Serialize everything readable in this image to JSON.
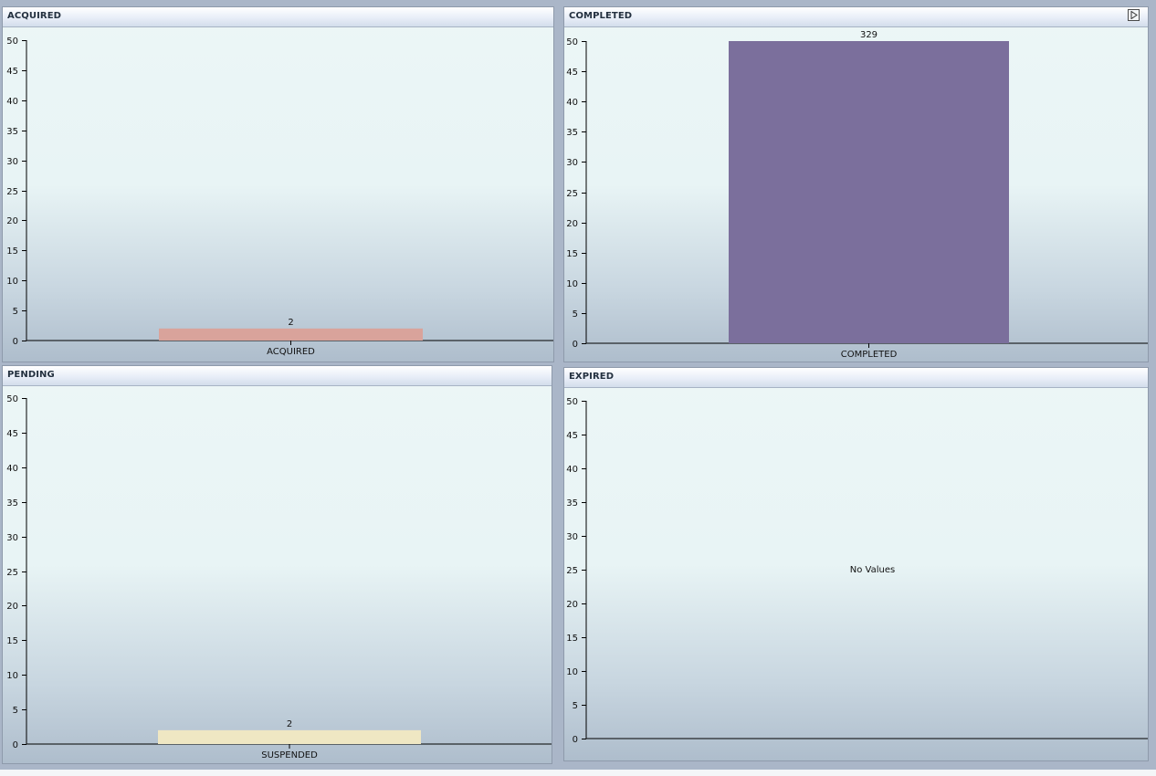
{
  "panels": [
    {
      "title": "ACQUIRED",
      "has_expand": false,
      "chart_data": {
        "type": "bar",
        "categories": [
          "ACQUIRED"
        ],
        "values": [
          2
        ],
        "value_labels": [
          "2"
        ],
        "ylim": [
          0,
          50
        ],
        "yticks": [
          0,
          5,
          10,
          15,
          20,
          25,
          30,
          35,
          40,
          45,
          50
        ],
        "color": "#d9a39b",
        "label_color": "#111111",
        "empty_message": ""
      }
    },
    {
      "title": "COMPLETED",
      "has_expand": true,
      "chart_data": {
        "type": "bar",
        "categories": [
          "COMPLETED"
        ],
        "values": [
          329
        ],
        "value_labels": [
          "329"
        ],
        "ylim": [
          0,
          50
        ],
        "yticks": [
          0,
          5,
          10,
          15,
          20,
          25,
          30,
          35,
          40,
          45,
          50
        ],
        "color": "#7b6f9c",
        "label_color": "#c0131b",
        "empty_message": ""
      }
    },
    {
      "title": "PENDING",
      "has_expand": false,
      "chart_data": {
        "type": "bar",
        "categories": [
          "SUSPENDED"
        ],
        "values": [
          2
        ],
        "value_labels": [
          "2"
        ],
        "ylim": [
          0,
          50
        ],
        "yticks": [
          0,
          5,
          10,
          15,
          20,
          25,
          30,
          35,
          40,
          45,
          50
        ],
        "color": "#efe7c3",
        "label_color": "#111111",
        "empty_message": ""
      }
    },
    {
      "title": "EXPIRED",
      "has_expand": false,
      "chart_data": {
        "type": "bar",
        "categories": [],
        "values": [],
        "value_labels": [],
        "ylim": [
          0,
          50
        ],
        "yticks": [
          0,
          5,
          10,
          15,
          20,
          25,
          30,
          35,
          40,
          45,
          50
        ],
        "color": "#7b6f9c",
        "label_color": "#111111",
        "empty_message": "No Values"
      }
    }
  ]
}
